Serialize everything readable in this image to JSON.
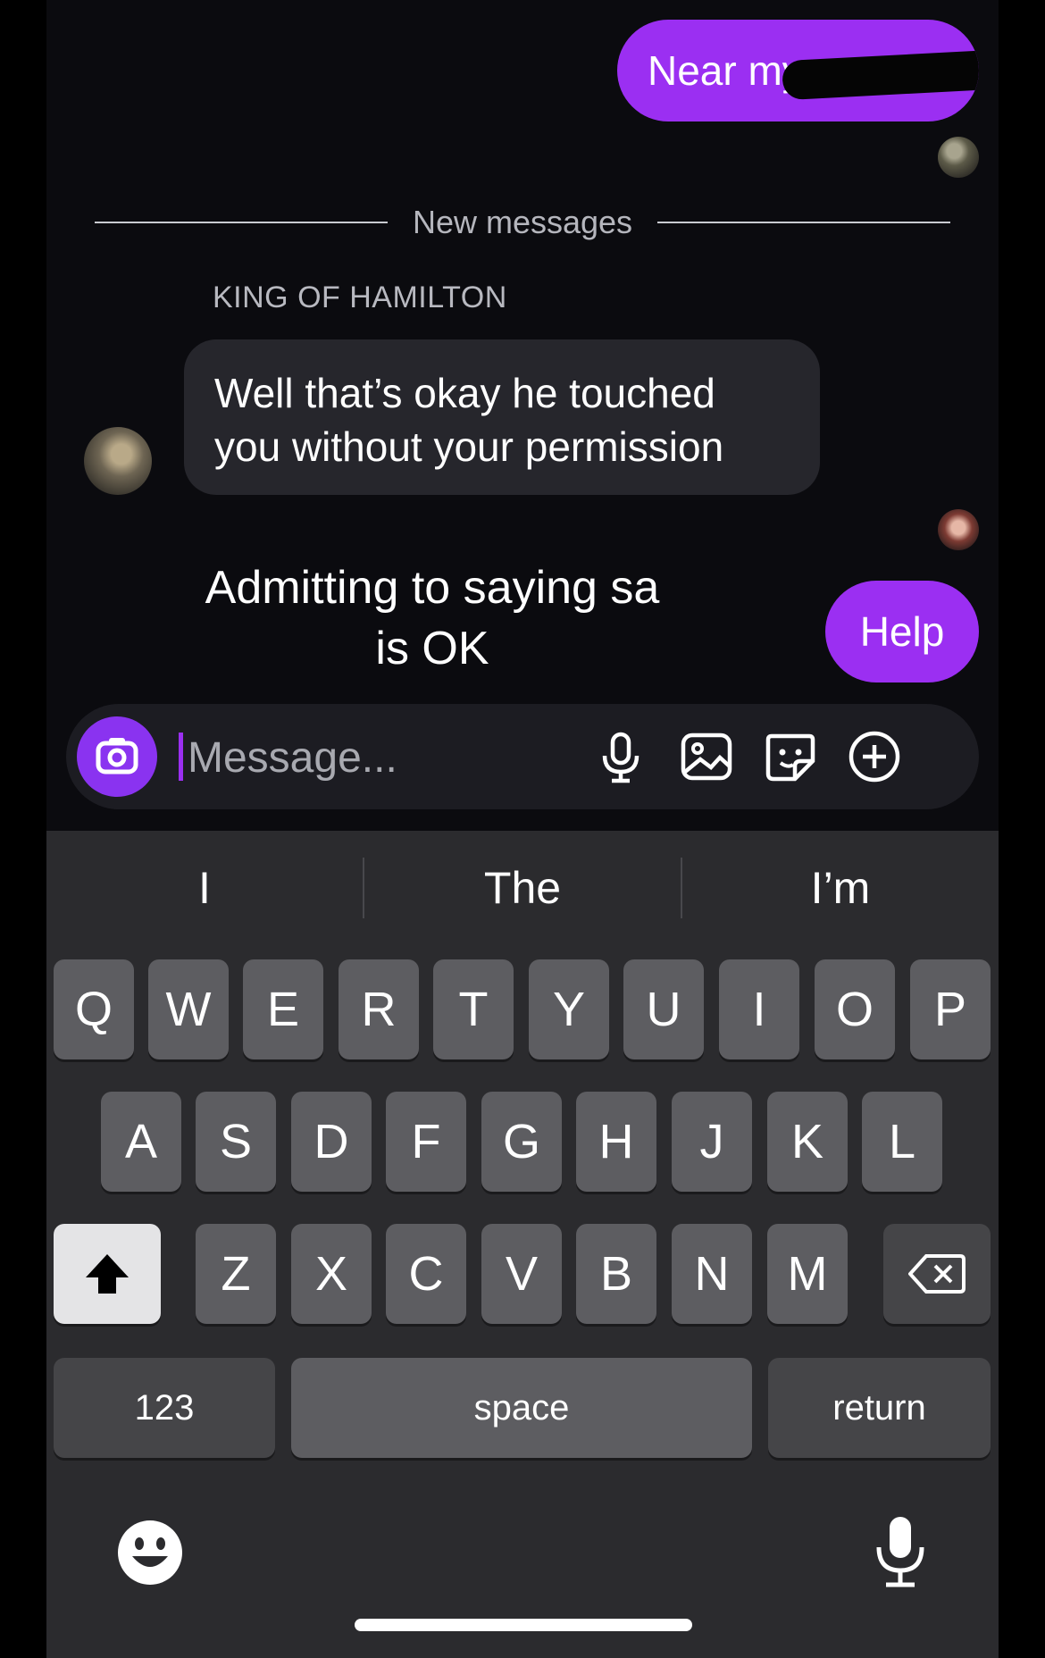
{
  "chat": {
    "outgoing_message": "Near my",
    "divider_label": "New messages",
    "sender_name": "KING OF HAMILTON",
    "incoming_message": "Well that’s okay he touched you without your permission",
    "overlay_caption": "Admitting to saying sa is OK",
    "outgoing_reply": "Help"
  },
  "composer": {
    "placeholder": "Message...",
    "icons": [
      "camera-icon",
      "microphone-icon",
      "gallery-icon",
      "sticker-icon",
      "plus-circle-icon"
    ]
  },
  "keyboard": {
    "suggestions": [
      "I",
      "The",
      "I’m"
    ],
    "row1": [
      "Q",
      "W",
      "E",
      "R",
      "T",
      "Y",
      "U",
      "I",
      "O",
      "P"
    ],
    "row2": [
      "A",
      "S",
      "D",
      "F",
      "G",
      "H",
      "J",
      "K",
      "L"
    ],
    "row3": [
      "Z",
      "X",
      "C",
      "V",
      "B",
      "N",
      "M"
    ],
    "numbers_label": "123",
    "space_label": "space",
    "return_label": "return",
    "icons": [
      "shift-icon",
      "backspace-icon",
      "emoji-icon",
      "dictation-icon"
    ]
  },
  "colors": {
    "accent_purple": "#9b2ff2",
    "background": "#0b0b0f",
    "incoming_bubble": "#26262c",
    "keyboard_bg": "#2b2b2e",
    "key": "#5d5d61"
  }
}
